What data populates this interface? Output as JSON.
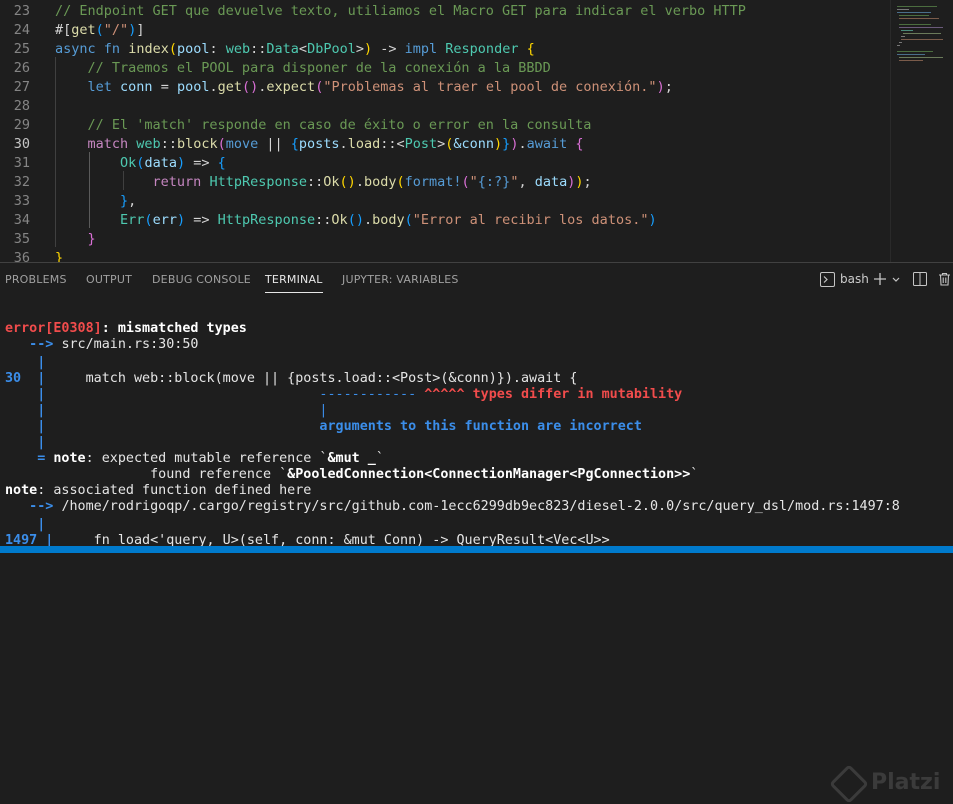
{
  "editor": {
    "lines": [
      {
        "no": "23",
        "segments": [
          {
            "t": "// Endpoint GET que devuelve texto, utiliamos el Macro GET para indicar el verbo HTTP",
            "c": "c-cm"
          }
        ]
      },
      {
        "no": "24",
        "segments": [
          {
            "t": "#[",
            "c": "c-pl"
          },
          {
            "t": "get",
            "c": "c-fn"
          },
          {
            "t": "(",
            "c": "c-b3"
          },
          {
            "t": "\"/\"",
            "c": "c-str"
          },
          {
            "t": ")",
            "c": "c-b3"
          },
          {
            "t": "]",
            "c": "c-pl"
          }
        ]
      },
      {
        "no": "25",
        "segments": [
          {
            "t": "async",
            "c": "c-kw"
          },
          {
            "t": " ",
            "c": "c-pl"
          },
          {
            "t": "fn",
            "c": "c-kw"
          },
          {
            "t": " ",
            "c": "c-pl"
          },
          {
            "t": "index",
            "c": "c-fn"
          },
          {
            "t": "(",
            "c": "c-b1"
          },
          {
            "t": "pool",
            "c": "c-var"
          },
          {
            "t": ": ",
            "c": "c-pl"
          },
          {
            "t": "web",
            "c": "c-ty"
          },
          {
            "t": "::",
            "c": "c-pl"
          },
          {
            "t": "Data",
            "c": "c-ty"
          },
          {
            "t": "<",
            "c": "c-pl"
          },
          {
            "t": "DbPool",
            "c": "c-ty"
          },
          {
            "t": ">",
            "c": "c-pl"
          },
          {
            "t": ")",
            "c": "c-b1"
          },
          {
            "t": " -> ",
            "c": "c-pl"
          },
          {
            "t": "impl",
            "c": "c-kw"
          },
          {
            "t": " ",
            "c": "c-pl"
          },
          {
            "t": "Responder",
            "c": "c-ty"
          },
          {
            "t": " ",
            "c": "c-pl"
          },
          {
            "t": "{",
            "c": "c-b1"
          }
        ]
      },
      {
        "no": "26",
        "segments": [
          {
            "t": "    // Traemos el POOL para disponer de la conexión a la BBDD",
            "c": "c-cm"
          }
        ]
      },
      {
        "no": "27",
        "segments": [
          {
            "t": "    ",
            "c": "c-pl"
          },
          {
            "t": "let",
            "c": "c-kw"
          },
          {
            "t": " ",
            "c": "c-pl"
          },
          {
            "t": "conn",
            "c": "c-var"
          },
          {
            "t": " = ",
            "c": "c-pl"
          },
          {
            "t": "pool",
            "c": "c-var"
          },
          {
            "t": ".",
            "c": "c-pl"
          },
          {
            "t": "get",
            "c": "c-fn"
          },
          {
            "t": "()",
            "c": "c-b2"
          },
          {
            "t": ".",
            "c": "c-pl"
          },
          {
            "t": "expect",
            "c": "c-fn"
          },
          {
            "t": "(",
            "c": "c-b2"
          },
          {
            "t": "\"Problemas al traer el pool de conexión.\"",
            "c": "c-str"
          },
          {
            "t": ")",
            "c": "c-b2"
          },
          {
            "t": ";",
            "c": "c-pl"
          }
        ]
      },
      {
        "no": "28",
        "segments": []
      },
      {
        "no": "29",
        "segments": [
          {
            "t": "    // El 'match' responde en caso de éxito o error en la consulta",
            "c": "c-cm"
          }
        ]
      },
      {
        "no": "30",
        "segments": [
          {
            "t": "    ",
            "c": "c-pl"
          },
          {
            "t": "match",
            "c": "c-ctl"
          },
          {
            "t": " ",
            "c": "c-pl"
          },
          {
            "t": "web",
            "c": "c-ty"
          },
          {
            "t": "::",
            "c": "c-pl"
          },
          {
            "t": "block",
            "c": "c-fn"
          },
          {
            "t": "(",
            "c": "c-b2"
          },
          {
            "t": "move",
            "c": "c-kw"
          },
          {
            "t": " || ",
            "c": "c-pl"
          },
          {
            "t": "{",
            "c": "c-b3"
          },
          {
            "t": "posts",
            "c": "c-var"
          },
          {
            "t": ".",
            "c": "c-pl"
          },
          {
            "t": "load",
            "c": "c-fn"
          },
          {
            "t": "::<",
            "c": "c-pl"
          },
          {
            "t": "Post",
            "c": "c-ty"
          },
          {
            "t": ">",
            "c": "c-pl"
          },
          {
            "t": "(",
            "c": "c-b1"
          },
          {
            "t": "&conn",
            "c": "c-var"
          },
          {
            "t": ")",
            "c": "c-b1"
          },
          {
            "t": "}",
            "c": "c-b3"
          },
          {
            "t": ")",
            "c": "c-b2"
          },
          {
            "t": ".",
            "c": "c-pl"
          },
          {
            "t": "await",
            "c": "c-kw"
          },
          {
            "t": " ",
            "c": "c-pl"
          },
          {
            "t": "{",
            "c": "c-b2"
          }
        ]
      },
      {
        "no": "31",
        "segments": [
          {
            "t": "        ",
            "c": "c-pl"
          },
          {
            "t": "Ok",
            "c": "c-ty"
          },
          {
            "t": "(",
            "c": "c-b3"
          },
          {
            "t": "data",
            "c": "c-var"
          },
          {
            "t": ")",
            "c": "c-b3"
          },
          {
            "t": " => ",
            "c": "c-pl"
          },
          {
            "t": "{",
            "c": "c-b3"
          }
        ]
      },
      {
        "no": "32",
        "segments": [
          {
            "t": "            ",
            "c": "c-pl"
          },
          {
            "t": "return",
            "c": "c-ctl"
          },
          {
            "t": " ",
            "c": "c-pl"
          },
          {
            "t": "HttpResponse",
            "c": "c-ty"
          },
          {
            "t": "::",
            "c": "c-pl"
          },
          {
            "t": "Ok",
            "c": "c-fn"
          },
          {
            "t": "()",
            "c": "c-b1"
          },
          {
            "t": ".",
            "c": "c-pl"
          },
          {
            "t": "body",
            "c": "c-fn"
          },
          {
            "t": "(",
            "c": "c-b1"
          },
          {
            "t": "format!",
            "c": "c-kw"
          },
          {
            "t": "(",
            "c": "c-b2"
          },
          {
            "t": "\"",
            "c": "c-str"
          },
          {
            "t": "{:?}",
            "c": "c-kw"
          },
          {
            "t": "\"",
            "c": "c-str"
          },
          {
            "t": ", ",
            "c": "c-pl"
          },
          {
            "t": "data",
            "c": "c-var"
          },
          {
            "t": ")",
            "c": "c-b2"
          },
          {
            "t": ")",
            "c": "c-b1"
          },
          {
            "t": ";",
            "c": "c-pl"
          }
        ]
      },
      {
        "no": "33",
        "segments": [
          {
            "t": "        ",
            "c": "c-pl"
          },
          {
            "t": "}",
            "c": "c-b3"
          },
          {
            "t": ",",
            "c": "c-pl"
          }
        ]
      },
      {
        "no": "34",
        "segments": [
          {
            "t": "        ",
            "c": "c-pl"
          },
          {
            "t": "Err",
            "c": "c-ty"
          },
          {
            "t": "(",
            "c": "c-b3"
          },
          {
            "t": "err",
            "c": "c-var"
          },
          {
            "t": ")",
            "c": "c-b3"
          },
          {
            "t": " => ",
            "c": "c-pl"
          },
          {
            "t": "HttpResponse",
            "c": "c-ty"
          },
          {
            "t": "::",
            "c": "c-pl"
          },
          {
            "t": "Ok",
            "c": "c-fn"
          },
          {
            "t": "()",
            "c": "c-b3"
          },
          {
            "t": ".",
            "c": "c-pl"
          },
          {
            "t": "body",
            "c": "c-fn"
          },
          {
            "t": "(",
            "c": "c-b3"
          },
          {
            "t": "\"Error al recibir los datos.\"",
            "c": "c-str"
          },
          {
            "t": ")",
            "c": "c-b3"
          }
        ]
      },
      {
        "no": "35",
        "segments": [
          {
            "t": "    ",
            "c": "c-pl"
          },
          {
            "t": "}",
            "c": "c-b2"
          }
        ]
      },
      {
        "no": "36",
        "segments": [
          {
            "t": "}",
            "c": "c-b1"
          }
        ]
      }
    ],
    "active_line": "30"
  },
  "panel": {
    "tabs": [
      {
        "label": "PROBLEMS",
        "active": false
      },
      {
        "label": "OUTPUT",
        "active": false
      },
      {
        "label": "DEBUG CONSOLE",
        "active": false
      },
      {
        "label": "TERMINAL",
        "active": true
      },
      {
        "label": "JUPYTER: VARIABLES",
        "active": false
      }
    ],
    "terminal_name": "bash",
    "icons": [
      "terminal-icon",
      "add-icon",
      "chevron-down-icon",
      "split-icon",
      "maximize-icon",
      "trash-icon"
    ]
  },
  "terminal": {
    "lines": [
      [
        {
          "t": "error[E0308]",
          "c": "t-err"
        },
        {
          "t": ": mismatched types",
          "c": "t-b"
        }
      ],
      [
        {
          "t": "   --> ",
          "c": "t-blueb"
        },
        {
          "t": "src/main.rs:30:50",
          "c": "t-w"
        }
      ],
      [
        {
          "t": "    |",
          "c": "t-blueb"
        }
      ],
      [
        {
          "t": "30",
          "c": "t-blueb"
        },
        {
          "t": "  |",
          "c": "t-blueb"
        },
        {
          "t": "     match web::block(move || {posts.load::<Post>(&conn)}).await {",
          "c": "t-w"
        }
      ],
      [
        {
          "t": "    |",
          "c": "t-blueb"
        },
        {
          "t": "                                  ",
          "c": "t-w"
        },
        {
          "t": "------------",
          "c": "t-blue"
        },
        {
          "t": " ",
          "c": "t-w"
        },
        {
          "t": "^^^^^ types differ in mutability",
          "c": "t-redb"
        }
      ],
      [
        {
          "t": "    |",
          "c": "t-blueb"
        },
        {
          "t": "                                  ",
          "c": "t-w"
        },
        {
          "t": "|",
          "c": "t-blue"
        }
      ],
      [
        {
          "t": "    |",
          "c": "t-blueb"
        },
        {
          "t": "                                  ",
          "c": "t-w"
        },
        {
          "t": "arguments to this function are incorrect",
          "c": "t-blueb"
        }
      ],
      [
        {
          "t": "    |",
          "c": "t-blueb"
        }
      ],
      [
        {
          "t": "    = ",
          "c": "t-blueb"
        },
        {
          "t": "note",
          "c": "t-b"
        },
        {
          "t": ": expected mutable reference `",
          "c": "t-w"
        },
        {
          "t": "&mut _",
          "c": "t-b"
        },
        {
          "t": "`",
          "c": "t-w"
        }
      ],
      [
        {
          "t": "                  found reference `",
          "c": "t-w"
        },
        {
          "t": "&PooledConnection<ConnectionManager<PgConnection>>",
          "c": "t-b"
        },
        {
          "t": "`",
          "c": "t-w"
        }
      ],
      [
        {
          "t": "note",
          "c": "t-b"
        },
        {
          "t": ": associated function defined here",
          "c": "t-w"
        }
      ],
      [
        {
          "t": "   --> ",
          "c": "t-blueb"
        },
        {
          "t": "/home/rodrigoqp/.cargo/registry/src/github.com-1ecc6299db9ec823/diesel-2.0.0/src/query_dsl/mod.rs:1497:8",
          "c": "t-w"
        }
      ],
      [
        {
          "t": "    |",
          "c": "t-blueb"
        }
      ],
      [
        {
          "t": "1497",
          "c": "t-blueb"
        },
        {
          "t": " |",
          "c": "t-blueb"
        },
        {
          "t": "     fn load<'query, U>(self, conn: &mut Conn) -> QueryResult<Vec<U>>",
          "c": "t-w"
        }
      ]
    ]
  },
  "watermark": {
    "text": "Platzi"
  },
  "colors": {
    "accent": "#007acc",
    "background": "#1e1e1e",
    "error": "#f14c4c",
    "info": "#3b8eea"
  }
}
